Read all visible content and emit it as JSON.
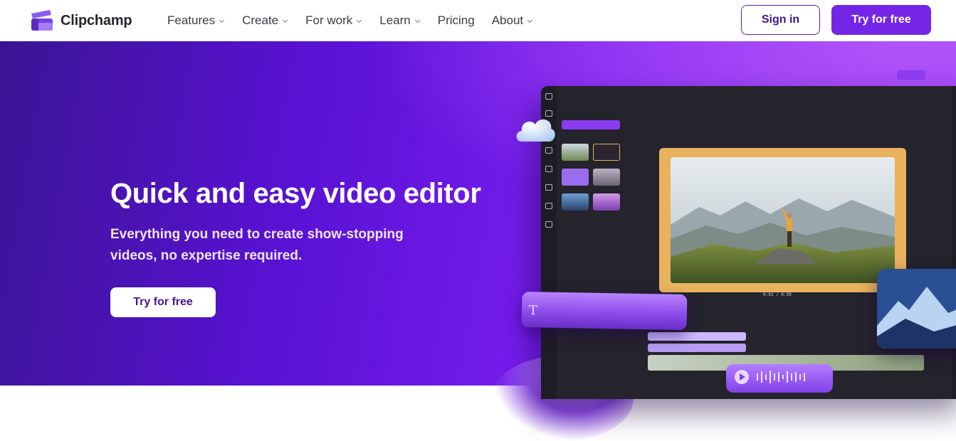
{
  "brand": {
    "name": "Clipchamp"
  },
  "nav": {
    "items": [
      {
        "label": "Features",
        "has_dropdown": true
      },
      {
        "label": "Create",
        "has_dropdown": true
      },
      {
        "label": "For work",
        "has_dropdown": true
      },
      {
        "label": "Learn",
        "has_dropdown": true
      },
      {
        "label": "Pricing",
        "has_dropdown": false
      },
      {
        "label": "About",
        "has_dropdown": true
      }
    ],
    "sign_in": "Sign in",
    "try_free": "Try for free"
  },
  "hero": {
    "title": "Quick and easy video editor",
    "subtitle_line1": "Everything you need to create show-stopping",
    "subtitle_line2": "videos, no expertise required.",
    "cta": "Try for free"
  },
  "editor_preview": {
    "timecode": "0:02 / 0:30",
    "text_tool_glyph": "T"
  },
  "colors": {
    "accent": "#7425e6",
    "brand_dark": "#3e1688",
    "hero_start": "#3b1493",
    "hero_end": "#8d35f6"
  }
}
